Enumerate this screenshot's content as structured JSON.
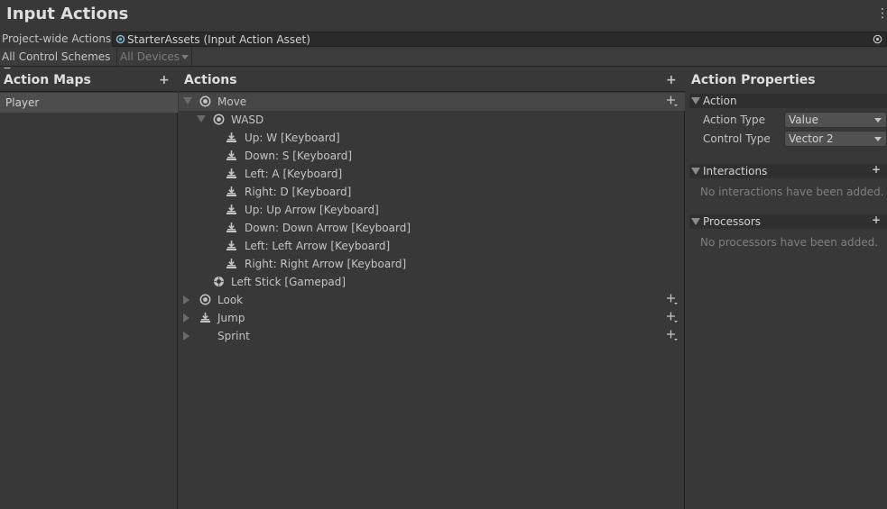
{
  "window": {
    "title": "Input Actions"
  },
  "project_wide": {
    "label": "Project-wide Actions",
    "value": "StarterAssets (Input Action Asset)"
  },
  "toolbar": {
    "control_schemes": "All Control Schemes",
    "devices": "All Devices"
  },
  "action_maps": {
    "title": "Action Maps",
    "plus": "+",
    "items": [
      {
        "label": "Player"
      }
    ]
  },
  "actions": {
    "title": "Actions",
    "plus": "+",
    "rows": [
      {
        "label": "Move",
        "kind": "action",
        "icon": "value-action-icon",
        "expanded": true,
        "selected": true
      },
      {
        "label": "WASD",
        "kind": "composite",
        "icon": "composite-icon",
        "expanded": true
      },
      {
        "label": "Up: W [Keyboard]",
        "kind": "part",
        "icon": "binding-icon"
      },
      {
        "label": "Down: S [Keyboard]",
        "kind": "part",
        "icon": "binding-icon"
      },
      {
        "label": "Left: A [Keyboard]",
        "kind": "part",
        "icon": "binding-icon"
      },
      {
        "label": "Right: D [Keyboard]",
        "kind": "part",
        "icon": "binding-icon"
      },
      {
        "label": "Up: Up Arrow [Keyboard]",
        "kind": "part",
        "icon": "binding-icon"
      },
      {
        "label": "Down: Down Arrow [Keyboard]",
        "kind": "part",
        "icon": "binding-icon"
      },
      {
        "label": "Left: Left Arrow [Keyboard]",
        "kind": "part",
        "icon": "binding-icon"
      },
      {
        "label": "Right: Right Arrow [Keyboard]",
        "kind": "part",
        "icon": "binding-icon"
      },
      {
        "label": "Left Stick [Gamepad]",
        "kind": "binding",
        "icon": "gamepad-stick-icon"
      },
      {
        "label": "Look",
        "kind": "action",
        "icon": "value-action-icon",
        "expanded": false
      },
      {
        "label": "Jump",
        "kind": "action",
        "icon": "button-action-icon",
        "expanded": false
      },
      {
        "label": "Sprint",
        "kind": "action",
        "icon": "",
        "expanded": false
      }
    ]
  },
  "action_properties": {
    "title": "Action Properties",
    "action_section": {
      "title": "Action",
      "action_type_label": "Action Type",
      "action_type_value": "Value",
      "control_type_label": "Control Type",
      "control_type_value": "Vector 2"
    },
    "interactions": {
      "title": "Interactions",
      "plus": "+",
      "empty": "No interactions have been added."
    },
    "processors": {
      "title": "Processors",
      "plus": "+",
      "empty": "No processors have been added."
    }
  },
  "colors": {
    "background": "#383838",
    "selected_row": "#464646",
    "selected_map": "#4d4d4d",
    "text": "#c4c4c4"
  }
}
